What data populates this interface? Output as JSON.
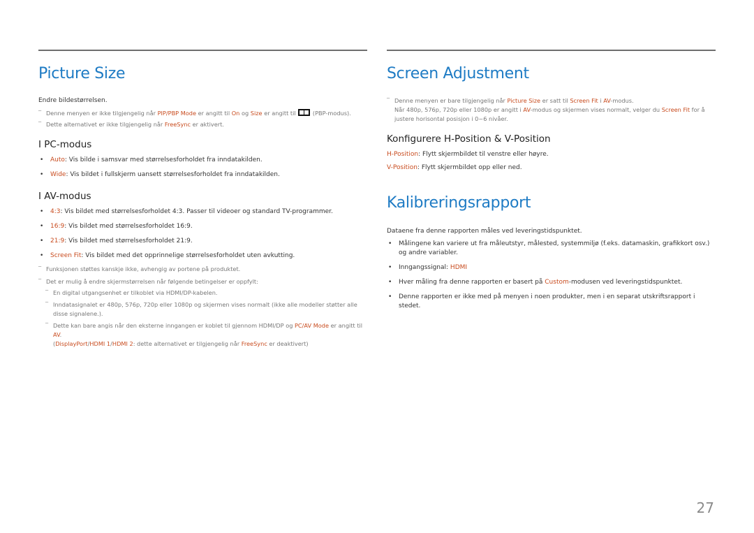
{
  "page_number": "27",
  "left": {
    "title": "Picture Size",
    "intro": "Endre bildestørrelsen.",
    "notes": [
      {
        "parts": [
          {
            "t": "Denne menyen er ikke tilgjengelig når "
          },
          {
            "t": "PIP/PBP Mode",
            "hl": true
          },
          {
            "t": " er angitt til "
          },
          {
            "t": "On",
            "hl": true
          },
          {
            "t": " og "
          },
          {
            "t": "Size",
            "hl": true
          },
          {
            "t": " er angitt til "
          },
          {
            "icon": "pbp-icon"
          },
          {
            "t": " (PBP-modus)."
          }
        ]
      },
      {
        "parts": [
          {
            "t": "Dette alternativet er ikke tilgjengelig når "
          },
          {
            "t": "FreeSync",
            "hl": true
          },
          {
            "t": " er aktivert."
          }
        ]
      }
    ],
    "pc_heading": "I PC-modus",
    "pc_items": [
      {
        "key": "Auto",
        "text": ": Vis bilde i samsvar med størrelsesforholdet fra inndatakilden."
      },
      {
        "key": "Wide",
        "text": ": Vis bildet i fullskjerm uansett størrelsesforholdet fra inndatakilden."
      }
    ],
    "av_heading": "I AV-modus",
    "av_items": [
      {
        "key": "4:3",
        "text": ": Vis bildet med størrelsesforholdet 4:3. Passer til videoer og standard TV-programmer."
      },
      {
        "key": "16:9",
        "text": ": Vis bildet med størrelsesforholdet 16:9."
      },
      {
        "key": "21:9",
        "text": ": Vis bildet med størrelsesforholdet 21:9."
      },
      {
        "key": "Screen Fit",
        "text": ": Vis bildet med det opprinnelige størrelsesforholdet uten avkutting."
      }
    ],
    "footnotes": {
      "n1": "Funksjonen støttes kanskje ikke, avhengig av portene på produktet.",
      "n2": "Det er mulig å endre skjermstørrelsen når følgende betingelser er oppfylt:",
      "s1": "En digital utgangsenhet er tilkoblet via HDMI/DP-kabelen.",
      "s2": "Inndatasignalet er 480p, 576p, 720p eller 1080p og skjermen vises normalt (ikke alle modeller støtter alle disse signalene.).",
      "s3_a": "Dette kan bare angis når den eksterne inngangen er koblet til gjennom HDMI/DP og ",
      "s3_b": "PC/AV Mode",
      "s3_c": " er angitt til ",
      "s3_d": "AV",
      "s3_e": ".",
      "s4_a": "(",
      "s4_b": "DisplayPort",
      "s4_c": "/",
      "s4_d": "HDMI 1",
      "s4_e": "/",
      "s4_f": "HDMI 2",
      "s4_g": ": dette alternativet er tilgjengelig når ",
      "s4_h": "FreeSync",
      "s4_i": " er deaktivert)"
    }
  },
  "right": {
    "title": "Screen Adjustment",
    "note": {
      "a": "Denne menyen er bare tilgjengelig når ",
      "b": "Picture Size",
      "c": " er satt til ",
      "d": "Screen Fit",
      "e": " i ",
      "f": "AV",
      "g": "-modus.",
      "h": "Når 480p, 576p, 720p eller 1080p er angitt i ",
      "i": "AV",
      "j": "-modus og skjermen vises normalt, velger du ",
      "k": "Screen Fit",
      "l": " for å justere horisontal posisjon i 0~6 nivåer."
    },
    "config_heading": "Konfigurere H-Position & V-Position",
    "positions": [
      {
        "key": "H-Position",
        "text": ": Flytt skjermbildet til venstre eller høyre."
      },
      {
        "key": "V-Position",
        "text": ": Flytt skjermbildet opp eller ned."
      }
    ],
    "calib_title": "Kalibreringsrapport",
    "calib_intro": "Dataene fra denne rapporten måles ved leveringstidspunktet.",
    "calib_items": {
      "i1": "Målingene kan variere ut fra måleutstyr, målested, systemmiljø (f.eks. datamaskin, grafikkort osv.) og andre variabler.",
      "i2_a": "Inngangssignal: ",
      "i2_b": "HDMI",
      "i3_a": "Hver måling fra denne rapporten er basert på ",
      "i3_b": "Custom",
      "i3_c": "-modusen ved leveringstidspunktet.",
      "i4": "Denne rapporten er ikke med på menyen i noen produkter, men i en separat utskriftsrapport i stedet."
    }
  },
  "colors": {
    "title": "#1e7bc4",
    "highlight": "#c84b1e",
    "rule": "#6e6e6e"
  }
}
